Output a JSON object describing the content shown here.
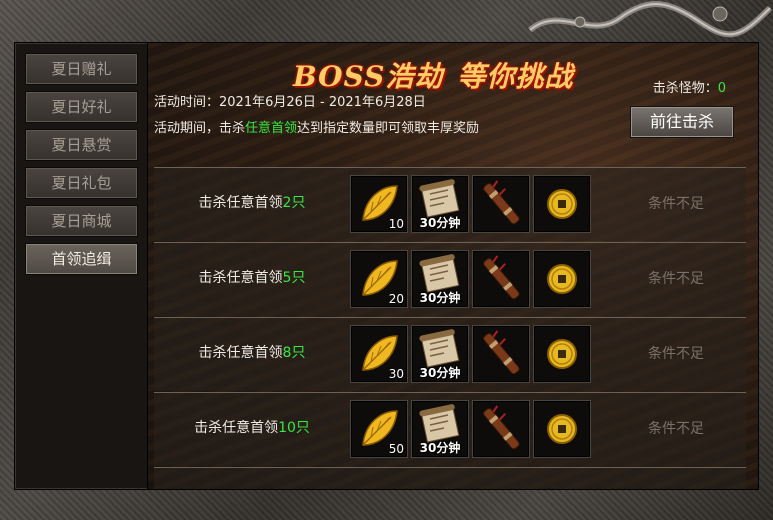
{
  "sidebar": {
    "items": [
      {
        "label": "夏日赠礼",
        "active": false
      },
      {
        "label": "夏日好礼",
        "active": false
      },
      {
        "label": "夏日悬赏",
        "active": false
      },
      {
        "label": "夏日礼包",
        "active": false
      },
      {
        "label": "夏日商城",
        "active": false
      },
      {
        "label": "首领追缉",
        "active": true
      }
    ]
  },
  "header": {
    "title_latin": "BOSS浩劫",
    "title_zh": "等你挑战",
    "time_prefix": "活动时间：",
    "time_value": "2021年6月26日 - 2021年6月28日",
    "desc_before": "活动期间，击杀",
    "desc_highlight": "任意首领",
    "desc_after": "达到指定数量即可领取丰厚奖励",
    "kill_label": "击杀怪物：",
    "kill_value": "0",
    "goto_button": "前往击杀"
  },
  "rows": [
    {
      "prefix": "击杀任意首领",
      "count": "2只",
      "leaf_qty": "10",
      "scroll_label": "30分钟",
      "status": "条件不足"
    },
    {
      "prefix": "击杀任意首领",
      "count": "5只",
      "leaf_qty": "20",
      "scroll_label": "30分钟",
      "status": "条件不足"
    },
    {
      "prefix": "击杀任意首领",
      "count": "8只",
      "leaf_qty": "30",
      "scroll_label": "30分钟",
      "status": "条件不足"
    },
    {
      "prefix": "击杀任意首领",
      "count": "10只",
      "leaf_qty": "50",
      "scroll_label": "30分钟",
      "status": "条件不足"
    }
  ],
  "icons": {
    "leaf": "golden-leaf-icon",
    "scroll": "scroll-icon",
    "bundle": "arrow-bundle-icon",
    "coin": "gold-coin-icon"
  },
  "colors": {
    "highlight": "#37e840",
    "title": "#ffcc66",
    "status_disabled": "#7a7168"
  }
}
